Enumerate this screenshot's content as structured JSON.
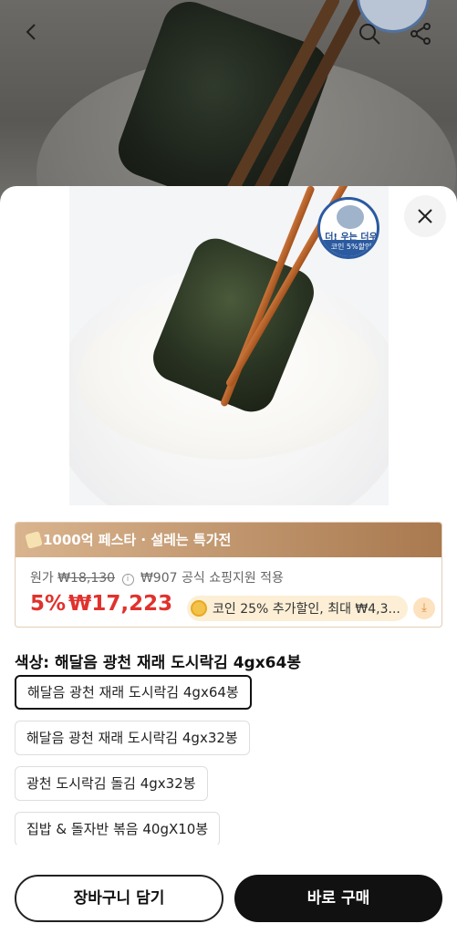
{
  "background": {
    "back_icon": "chevron-left-icon",
    "search_icon": "search-icon",
    "share_icon": "share-icon"
  },
  "sheet": {
    "close_icon": "close-icon",
    "badge": {
      "title": "더! 우는 더우",
      "bar": "코인 5%할인"
    }
  },
  "promo": {
    "label": "1000억 페스타 · 설레는 특가전"
  },
  "pricing": {
    "original_label": "원가",
    "original_price": "₩18,130",
    "support_text": "₩907 공식 쇼핑지원 적용",
    "discount": "5%",
    "price": "₩17,223",
    "coupon_text": "코인 25% 추가할인, 최대 ₩4,3..."
  },
  "options": {
    "title": "색상: 해달음 광천 재래 도시락김 4gx64봉",
    "items": [
      {
        "label": "해달음 광천 재래 도시락김 4gx64봉"
      },
      {
        "label": "해달음 광천 재래 도시락김 4gx32봉"
      },
      {
        "label": "광천 도시락김 돌김 4gx32봉"
      },
      {
        "label": "집밥 & 돌자반 볶음 40gX10봉"
      }
    ]
  },
  "actions": {
    "cart_label": "장바구니 담기",
    "buy_label": "바로 구매"
  },
  "colors": {
    "price_red": "#e0322d",
    "promo_gold": "#b98a5f",
    "buy_black": "#111111"
  }
}
